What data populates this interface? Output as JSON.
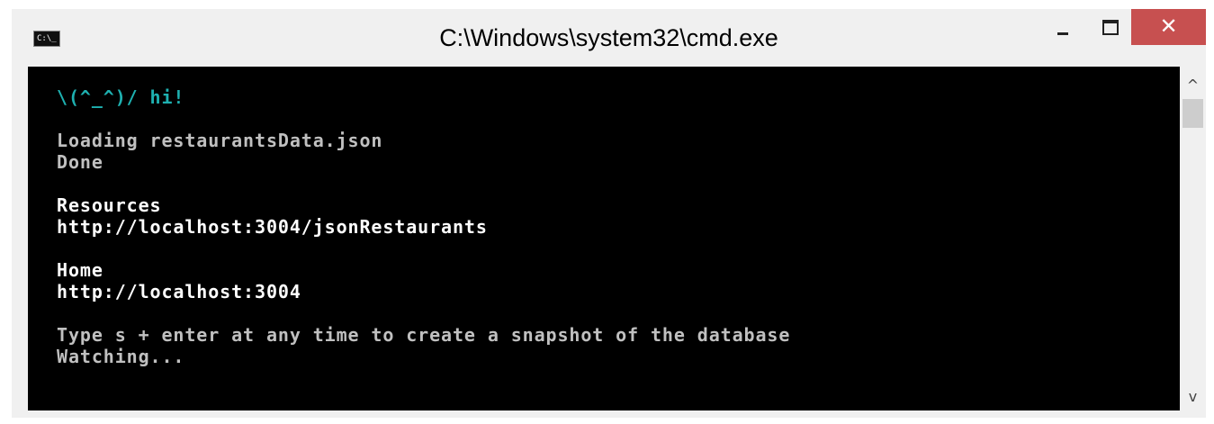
{
  "window": {
    "title": "C:\\Windows\\system32\\cmd.exe",
    "icon_text": "C:\\_"
  },
  "controls": {
    "close_glyph": "✕"
  },
  "console": {
    "lines": [
      {
        "text": "\\(^_^)/ hi!",
        "color": "#1eb0b0"
      },
      {
        "text": "",
        "color": "#c0c0c0"
      },
      {
        "text": "Loading restaurantsData.json",
        "color": "#c0c0c0"
      },
      {
        "text": "Done",
        "color": "#c0c0c0"
      },
      {
        "text": "",
        "color": "#c0c0c0"
      },
      {
        "text": "Resources",
        "color": "#ffffff"
      },
      {
        "text": "http://localhost:3004/jsonRestaurants",
        "color": "#ffffff"
      },
      {
        "text": "",
        "color": "#c0c0c0"
      },
      {
        "text": "Home",
        "color": "#ffffff"
      },
      {
        "text": "http://localhost:3004",
        "color": "#ffffff"
      },
      {
        "text": "",
        "color": "#c0c0c0"
      },
      {
        "text": "Type s + enter at any time to create a snapshot of the database",
        "color": "#c0c0c0"
      },
      {
        "text": "Watching...",
        "color": "#c0c0c0"
      }
    ]
  },
  "scrollbar": {
    "up_glyph": "^",
    "down_glyph": "v"
  }
}
